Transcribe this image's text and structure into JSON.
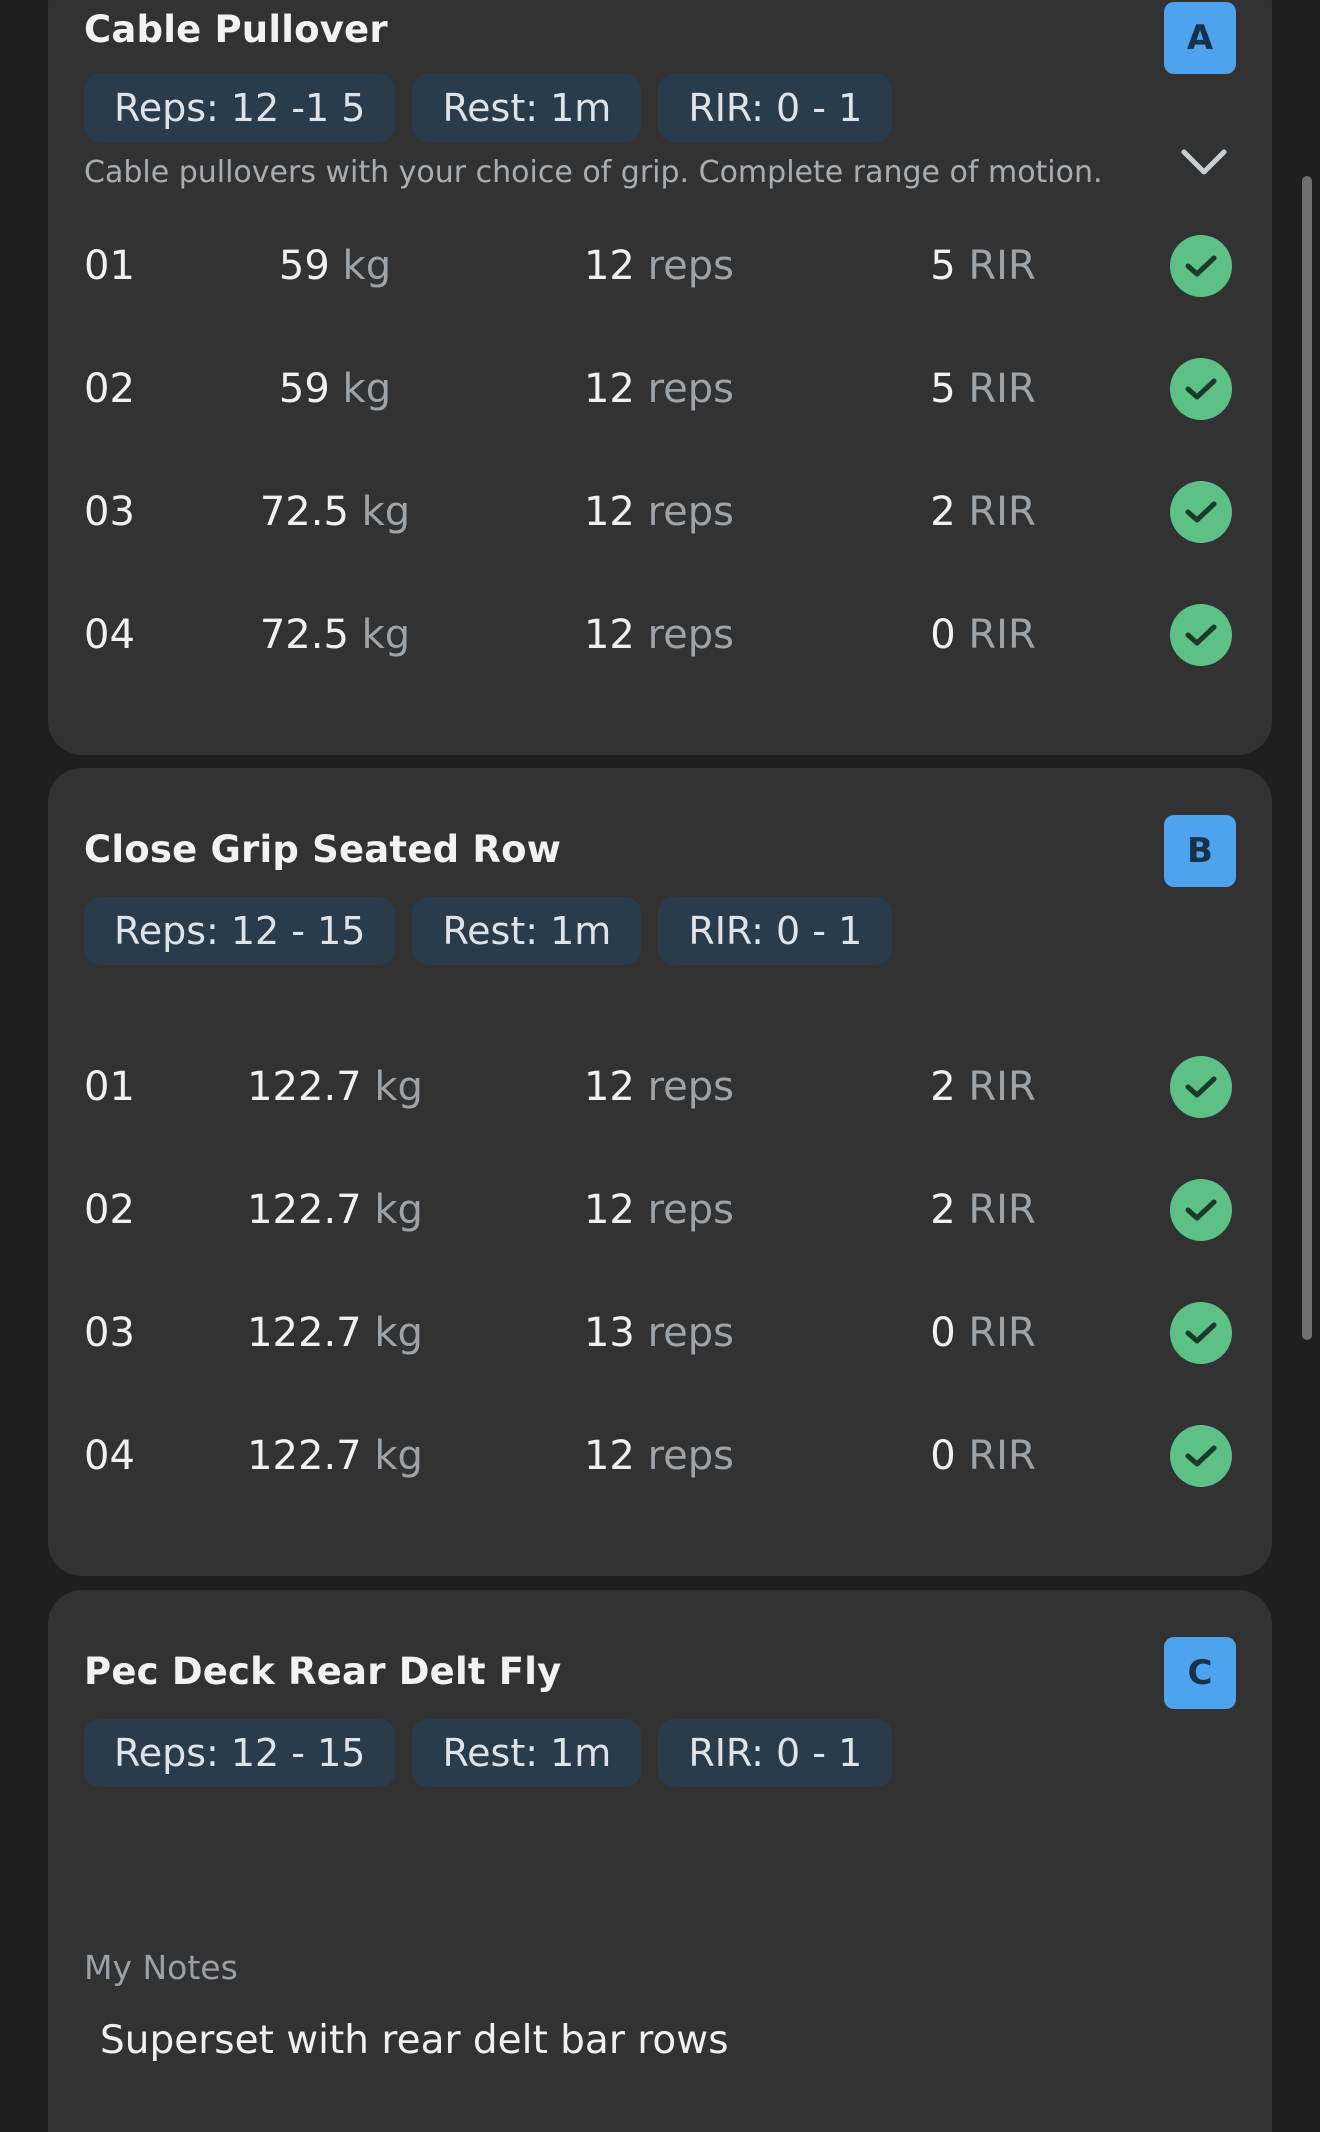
{
  "exercises": [
    {
      "title": "Cable Pullover",
      "badge": "A",
      "chips": {
        "reps": "Reps: 12 -1 5",
        "rest": "Rest: 1m",
        "rir": "RIR: 0 - 1"
      },
      "description": "Cable pullovers with your choice of grip. Complete range of motion.",
      "sets": [
        {
          "num": "01",
          "kg": "59",
          "reps": "12",
          "rir": "5"
        },
        {
          "num": "02",
          "kg": "59",
          "reps": "12",
          "rir": "5"
        },
        {
          "num": "03",
          "kg": "72.5",
          "reps": "12",
          "rir": "2"
        },
        {
          "num": "04",
          "kg": "72.5",
          "reps": "12",
          "rir": "0"
        }
      ]
    },
    {
      "title": "Close Grip Seated Row",
      "badge": "B",
      "chips": {
        "reps": "Reps: 12 - 15",
        "rest": "Rest: 1m",
        "rir": "RIR: 0 - 1"
      },
      "sets": [
        {
          "num": "01",
          "kg": "122.7",
          "reps": "12",
          "rir": "2"
        },
        {
          "num": "02",
          "kg": "122.7",
          "reps": "12",
          "rir": "2"
        },
        {
          "num": "03",
          "kg": "122.7",
          "reps": "13",
          "rir": "0"
        },
        {
          "num": "04",
          "kg": "122.7",
          "reps": "12",
          "rir": "0"
        }
      ]
    },
    {
      "title": "Pec Deck Rear Delt Fly",
      "badge": "C",
      "chips": {
        "reps": "Reps: 12 - 15",
        "rest": "Rest: 1m",
        "rir": "RIR: 0 - 1"
      },
      "notes_label": "My Notes",
      "notes_text": "Superset with rear delt bar rows"
    }
  ],
  "units": {
    "kg": "kg",
    "reps": "reps",
    "rir": "RIR"
  },
  "icons": {
    "expand": "chevron-down-icon",
    "done": "check-icon"
  },
  "colors": {
    "badge": "#4ea3ee",
    "check": "#5cc087",
    "chip": "#2a3c4c",
    "card": "#323232"
  }
}
